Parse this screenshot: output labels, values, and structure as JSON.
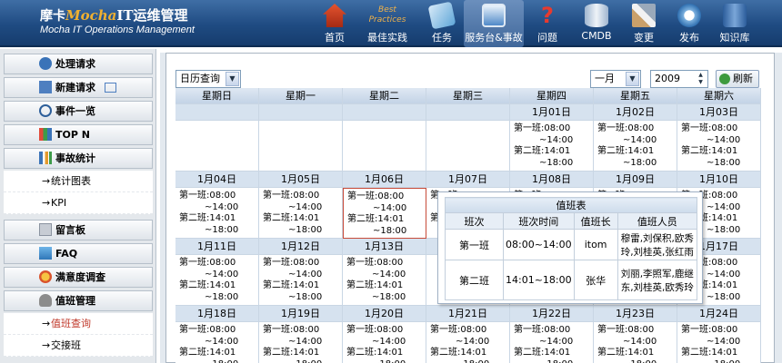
{
  "header": {
    "brand_left": "摩卡",
    "brand_mid": "Mocha",
    "brand_right": "IT运维管理",
    "subtitle": "Mocha IT Operations Management"
  },
  "nav": [
    {
      "label": "首页",
      "icon": "home-icon"
    },
    {
      "label": "最佳实践",
      "icon": "best-practices-icon",
      "badge": "Best Practices"
    },
    {
      "label": "任务",
      "icon": "task-icon"
    },
    {
      "label": "服务台&事故",
      "icon": "service-desk-icon"
    },
    {
      "label": "问题",
      "icon": "question-icon"
    },
    {
      "label": "CMDB",
      "icon": "database-icon"
    },
    {
      "label": "变更",
      "icon": "change-icon"
    },
    {
      "label": "发布",
      "icon": "release-icon"
    },
    {
      "label": "知识库",
      "icon": "knowledge-base-icon"
    }
  ],
  "sidebar": {
    "items": [
      {
        "label": "处理请求",
        "icon": "handle-request-icon"
      },
      {
        "label": "新建请求",
        "icon": "new-request-icon"
      },
      {
        "label": "事件一览",
        "icon": "event-list-icon"
      },
      {
        "label": "TOP N",
        "icon": "top-n-icon"
      },
      {
        "label": "事故统计",
        "icon": "incident-stats-icon"
      },
      {
        "label": "统计图表",
        "sub": true
      },
      {
        "label": "KPI",
        "sub": true
      },
      {
        "label": "留言板",
        "icon": "message-board-icon"
      },
      {
        "label": "FAQ",
        "icon": "faq-icon"
      },
      {
        "label": "满意度调查",
        "icon": "satisfaction-icon"
      },
      {
        "label": "值班管理",
        "icon": "duty-management-icon"
      },
      {
        "label": "值班查询",
        "sub": true,
        "active": true
      },
      {
        "label": "交接班",
        "sub": true
      }
    ]
  },
  "toolbar": {
    "view": "日历查询",
    "month": "一月",
    "year": "2009",
    "refresh": "刷新"
  },
  "calendar": {
    "weekdays": [
      "星期日",
      "星期一",
      "星期二",
      "星期三",
      "星期四",
      "星期五",
      "星期六"
    ],
    "weeks": [
      [
        "",
        "",
        "",
        "",
        "1月01日",
        "1月02日",
        "1月03日"
      ],
      [
        "1月04日",
        "1月05日",
        "1月06日",
        "1月07日",
        "1月08日",
        "1月09日",
        "1月10日"
      ],
      [
        "1月11日",
        "1月12日",
        "1月13日",
        "",
        "",
        "",
        "1月17日"
      ],
      [
        "1月18日",
        "1月19日",
        "1月20日",
        "1月21日",
        "1月22日",
        "1月23日",
        "1月24日"
      ]
    ],
    "shift_lines": [
      "第一班:08:00",
      "~14:00",
      "第二班:14:01",
      "~18:00"
    ]
  },
  "popup": {
    "title": "值班表",
    "headers": [
      "班次",
      "班次时间",
      "值班长",
      "值班人员"
    ],
    "rows": [
      [
        "第一班",
        "08:00~14:00",
        "itom",
        "穆雷,刘保积,欧秀玲,刘桂英,张红雨"
      ],
      [
        "第二班",
        "14:01~18:00",
        "张华",
        "刘丽,李照军,鹿继东,刘桂英,欧秀玲"
      ]
    ]
  }
}
